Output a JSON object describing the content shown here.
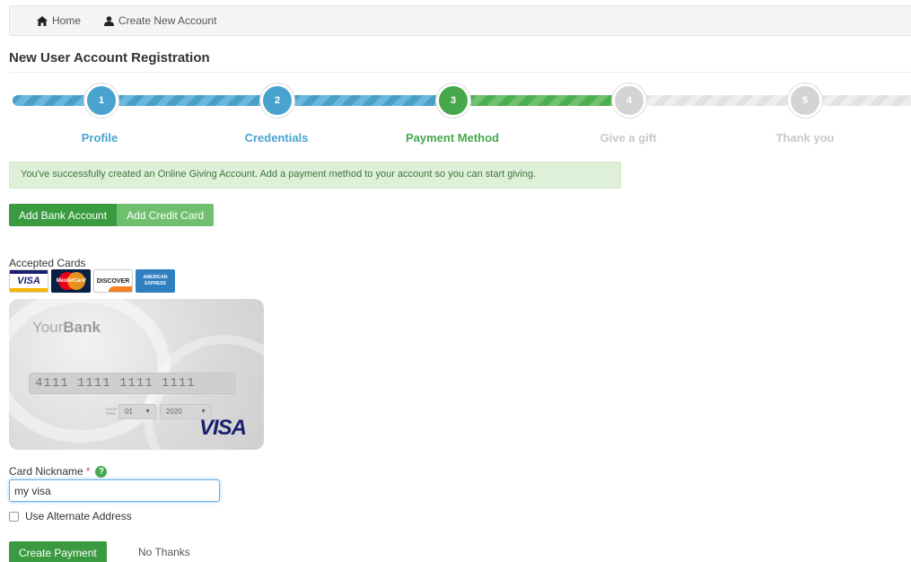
{
  "breadcrumb": {
    "home": "Home",
    "create": "Create New Account"
  },
  "page": {
    "title": "New User Account Registration"
  },
  "wizard": {
    "steps": [
      {
        "num": "1",
        "label": "Profile",
        "state": "done"
      },
      {
        "num": "2",
        "label": "Credentials",
        "state": "done"
      },
      {
        "num": "3",
        "label": "Payment Method",
        "state": "current"
      },
      {
        "num": "4",
        "label": "Give a gift",
        "state": "todo"
      },
      {
        "num": "5",
        "label": "Thank you",
        "state": "todo"
      }
    ]
  },
  "alert": {
    "text": "You've successfully created an Online Giving Account. Add a payment method to your account so you can start giving."
  },
  "tabs": {
    "bank": "Add Bank Account",
    "credit": "Add Credit Card"
  },
  "accepted": {
    "label": "Accepted Cards",
    "logos": {
      "visa": "VISA",
      "mastercard": "MasterCard",
      "discover": "DISCOVER",
      "amex": "AMERICAN EXPRESS"
    }
  },
  "card": {
    "bank_name_light": "Your",
    "bank_name_bold": "Bank",
    "number": "4111 1111 1111 1111",
    "good_thru": "GOOD THRU",
    "month": "01",
    "year": "2020",
    "brand": "VISA"
  },
  "form": {
    "nickname_label": "Card Nickname",
    "required_mark": "*",
    "help_icon": "?",
    "nickname_value": "my visa",
    "alt_address_label": "Use Alternate Address"
  },
  "actions": {
    "create": "Create Payment",
    "no_thanks": "No Thanks"
  },
  "colors": {
    "done": "#4aa3cf",
    "current": "#46a84b",
    "todo": "#d4d4d4",
    "button_green": "#3a9a40"
  }
}
